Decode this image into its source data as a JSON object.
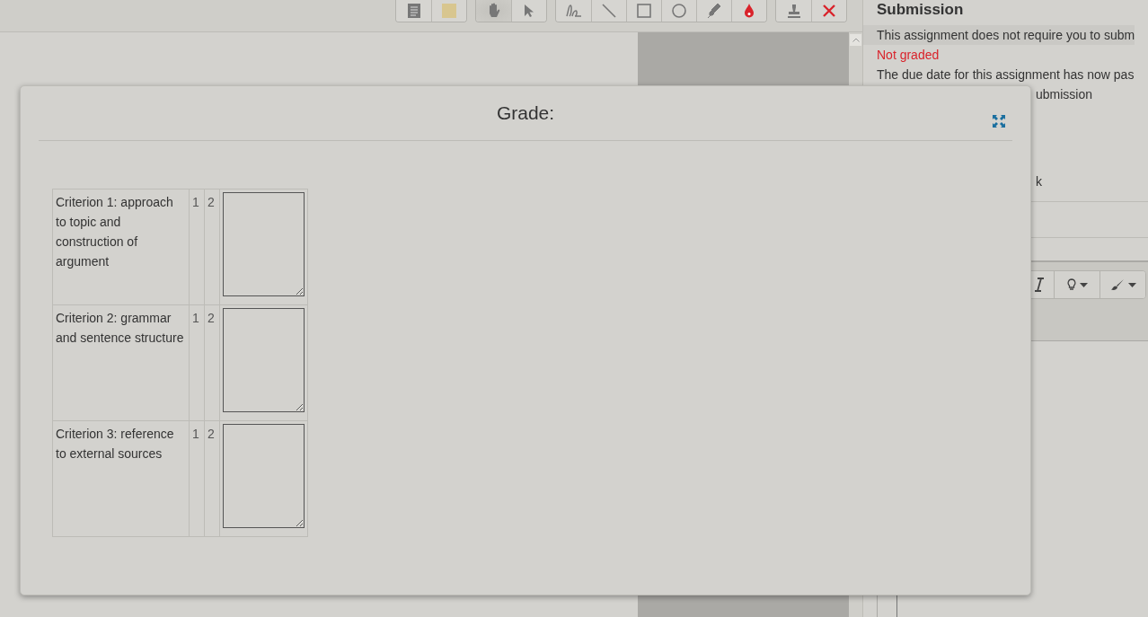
{
  "toolbar": {
    "groups": [
      {
        "tools": [
          {
            "kind": "page",
            "selected": false
          },
          {
            "kind": "note",
            "selected": false
          }
        ]
      },
      {
        "tools": [
          {
            "kind": "hand",
            "selected": true
          },
          {
            "kind": "pointer",
            "selected": false
          }
        ]
      },
      {
        "tools": [
          {
            "kind": "pen",
            "selected": false
          },
          {
            "kind": "line",
            "selected": false
          },
          {
            "kind": "rectangle",
            "selected": false
          },
          {
            "kind": "oval",
            "selected": false
          },
          {
            "kind": "highlighter",
            "selected": false
          },
          {
            "kind": "color",
            "selected": false
          }
        ]
      },
      {
        "tools": [
          {
            "kind": "stamp",
            "selected": false
          },
          {
            "kind": "delete",
            "selected": false
          }
        ]
      }
    ]
  },
  "submission": {
    "title": "Submission",
    "lines": [
      {
        "text": "This assignment does not require you to subm",
        "kind": "plain"
      },
      {
        "text": "Not graded",
        "kind": "alert"
      },
      {
        "text": "The due date for this assignment has now pas",
        "kind": "plain"
      },
      {
        "text": "ubmission",
        "kind": "partial"
      },
      {
        "text": "k",
        "kind": "partial-gap"
      }
    ]
  },
  "editor_toolbar": [
    {
      "kind": "italic"
    },
    {
      "kind": "lightbulb"
    },
    {
      "kind": "brush"
    }
  ],
  "modal": {
    "title": "Grade:",
    "criteria": [
      {
        "description": "Criterion 1: approach to topic and construction of argument",
        "levels": [
          "1",
          "2"
        ]
      },
      {
        "description": "Criterion 2: grammar and sentence structure",
        "levels": [
          "1",
          "2"
        ]
      },
      {
        "description": "Criterion 3: reference to external sources",
        "levels": [
          "1",
          "2"
        ]
      }
    ]
  }
}
